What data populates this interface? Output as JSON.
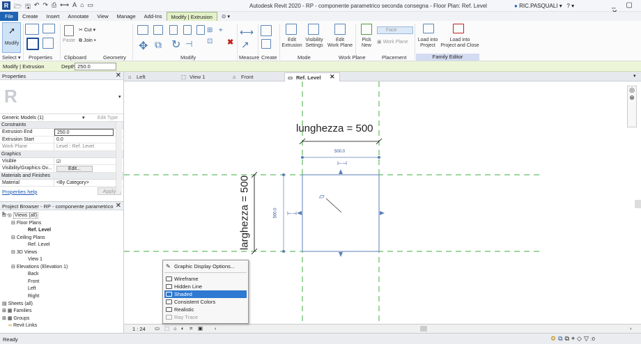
{
  "titlebar": {
    "title": "Autodesk Revit 2020 - RP - componente parametrico seconda consegna - Floor Plan: Ref. Level",
    "user": "RIC.PASQUALI",
    "window_controls": "_ ▢ ✕"
  },
  "ribbon_tabs": [
    "File",
    "Create",
    "Insert",
    "Annotate",
    "View",
    "Manage",
    "Add-Ins",
    "Modify | Extrusion"
  ],
  "ribbon": {
    "modify_label": "Modify",
    "cut_label": "Cut",
    "join_label": "Join",
    "paste_label": "Paste",
    "edit_extrusion": "Edit\nExtrusion",
    "visibility_settings": "Visibility\nSettings",
    "edit_work_plane": "Edit\nWork Plane",
    "pick_new": "Pick\nNew",
    "face_label": "Face",
    "work_plane_label": "Work Plane",
    "load_into_project": "Load into\nProject",
    "load_into_project_close": "Load into\nProject and Close",
    "panels": [
      "Select ▾",
      "Properties",
      "Clipboard",
      "Geometry",
      "Modify",
      "Measure",
      "Create",
      "Mode",
      "Work Plane",
      "Placement",
      "Family Editor"
    ]
  },
  "options_bar": {
    "context": "Modify | Extrusion",
    "depth_label": "Depth",
    "depth_value": "250.0"
  },
  "properties": {
    "header": "Properties",
    "type_selector": "Generic Models (1)",
    "edit_type": "Edit Type",
    "sections": {
      "constraints": "Constraints",
      "graphics": "Graphics",
      "materials": "Materials and Finishes"
    },
    "rows": {
      "extrusion_end": {
        "key": "Extrusion End",
        "value": "250.0"
      },
      "extrusion_start": {
        "key": "Extrusion Start",
        "value": "0.0"
      },
      "work_plane": {
        "key": "Work Plane",
        "value": "Level : Ref. Level"
      },
      "visible": {
        "key": "Visible",
        "value": "☑"
      },
      "visibility_overrides": {
        "key": "Visibility/Graphics Ov...",
        "value": "Edit..."
      },
      "material": {
        "key": "Material",
        "value": "<By Category>"
      }
    },
    "help_link": "Properties help",
    "apply": "Apply"
  },
  "project_browser": {
    "header": "Project Browser - RP - componente parametrico s...",
    "items": {
      "views_all": "Views (all)",
      "floor_plans": "Floor Plans",
      "ref_level": "Ref. Level",
      "ceiling_plans": "Ceiling Plans",
      "ceiling_ref_level": "Ref. Level",
      "views_3d": "3D Views",
      "view1": "View 1",
      "elevations": "Elevations (Elevation 1)",
      "back": "Back",
      "front": "Front",
      "left": "Left",
      "right": "Right",
      "sheets": "Sheets (all)",
      "families": "Families",
      "groups": "Groups",
      "revit_links": "Revit Links"
    }
  },
  "view_tabs": [
    "Left",
    "View 1",
    "Front",
    "Ref. Level"
  ],
  "canvas": {
    "width_label": "lunghezza = 500",
    "height_label": "larghezza = 500",
    "dim_top": "500.0",
    "dim_left": "500.0"
  },
  "view_control": {
    "scale": "1 : 24"
  },
  "visual_style_menu": {
    "items": [
      "Graphic Display Options...",
      "Wireframe",
      "Hidden Line",
      "Shaded",
      "Consistent Colors",
      "Realistic",
      "Ray Trace"
    ],
    "selected": "Shaded"
  },
  "status": {
    "text": "Ready",
    "filter_count": ":0"
  },
  "colors": {
    "ribbon_active": "#e3f1c9",
    "selection_blue": "#2e79d1",
    "reference_plane": "#3fae3f",
    "annotation_circle": "#d01010"
  }
}
